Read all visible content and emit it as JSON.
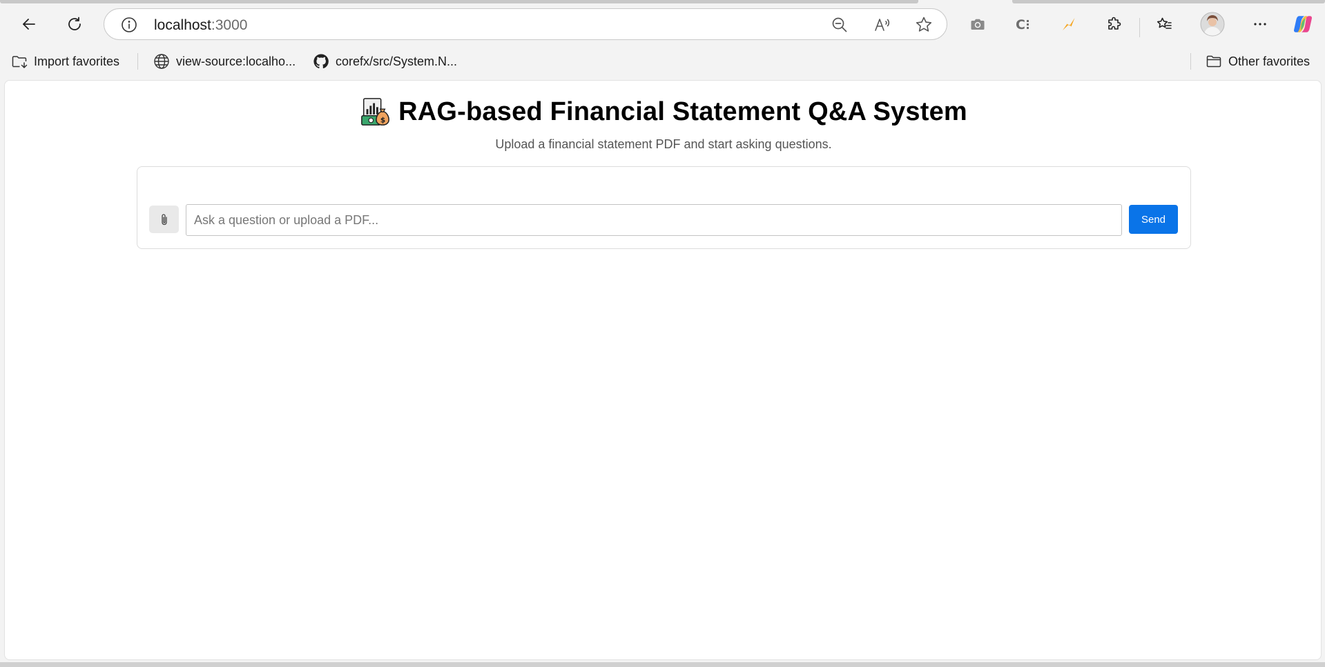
{
  "browser": {
    "url_host": "localhost",
    "url_port": ":3000",
    "icons": {
      "back": "back-arrow-icon",
      "refresh": "refresh-icon",
      "info": "info-icon",
      "zoom_out": "zoom-out-icon",
      "read_aloud": "read-aloud-icon",
      "favorite": "star-icon",
      "screenshot": "camera-icon",
      "extension_c": "extension-c-icon",
      "extension_bolt": "extension-bolt-icon",
      "extensions": "puzzle-icon",
      "favorites": "favorites-icon",
      "profile": "profile-avatar",
      "more": "more-icon",
      "copilot": "copilot-icon"
    }
  },
  "favorites_bar": {
    "items": [
      {
        "label": "Import favorites",
        "icon": "import-favorites-icon"
      },
      {
        "label": "view-source:localho...",
        "icon": "globe-icon"
      },
      {
        "label": "corefx/src/System.N...",
        "icon": "github-icon"
      }
    ],
    "other": {
      "label": "Other favorites",
      "icon": "folder-icon"
    }
  },
  "page": {
    "title": "RAG-based Financial Statement Q&A System",
    "title_icon": "finance-logo-icon",
    "subtitle": "Upload a financial statement PDF and start asking questions.",
    "chat": {
      "attach_icon": "paperclip-icon",
      "input_placeholder": "Ask a question or upload a PDF...",
      "input_value": "",
      "send_label": "Send"
    }
  },
  "colors": {
    "accent": "#0a74e8",
    "extension_bolt": "#f5a623"
  }
}
